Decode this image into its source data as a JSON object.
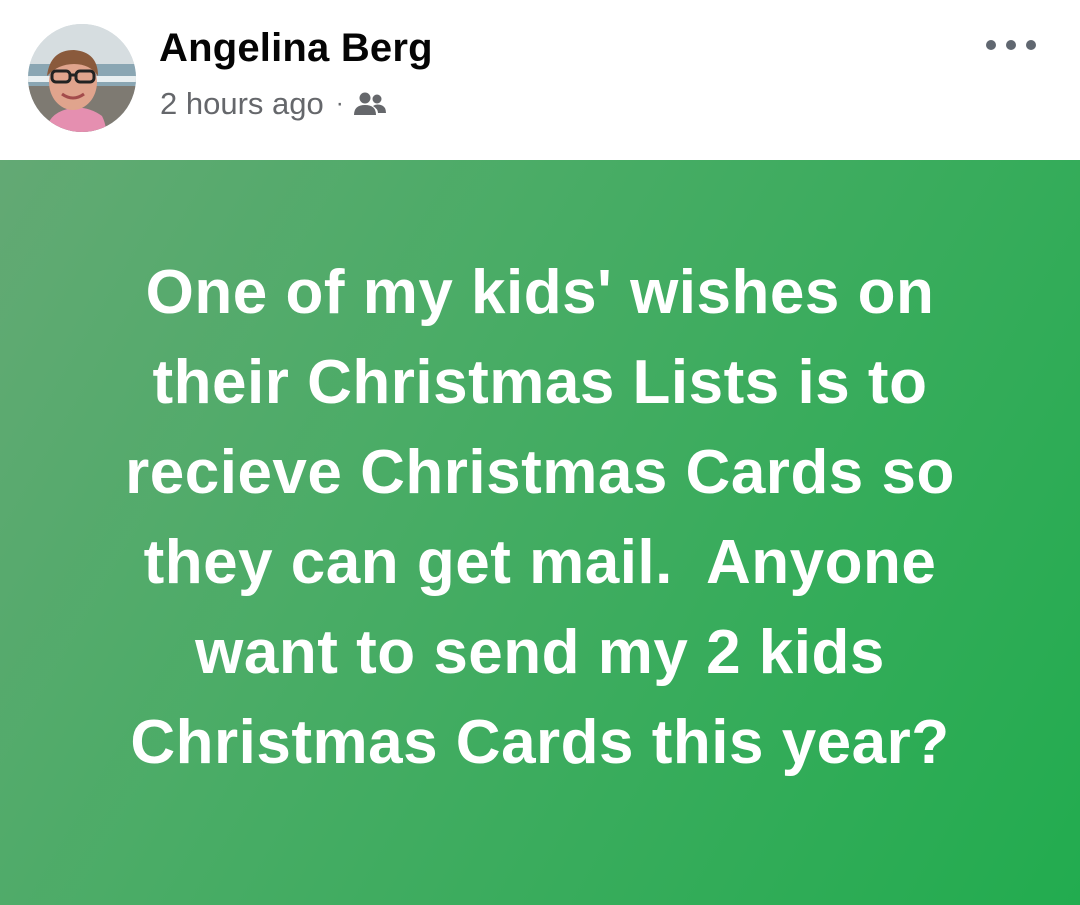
{
  "post": {
    "author_name": "Angelina Berg",
    "timestamp": "2 hours ago",
    "separator": "·",
    "audience_icon": "friends-icon",
    "more_icon": "more-options-icon",
    "background_colors": [
      "#63a974",
      "#22ac4f"
    ],
    "text_color": "#ffffff",
    "body_lines": [
      "One of my kids' wishes on",
      "their Christmas Lists is to",
      "recieve Christmas Cards so",
      "they can get mail.  Anyone",
      "want to send my 2 kids",
      "Christmas Cards this year?"
    ]
  }
}
